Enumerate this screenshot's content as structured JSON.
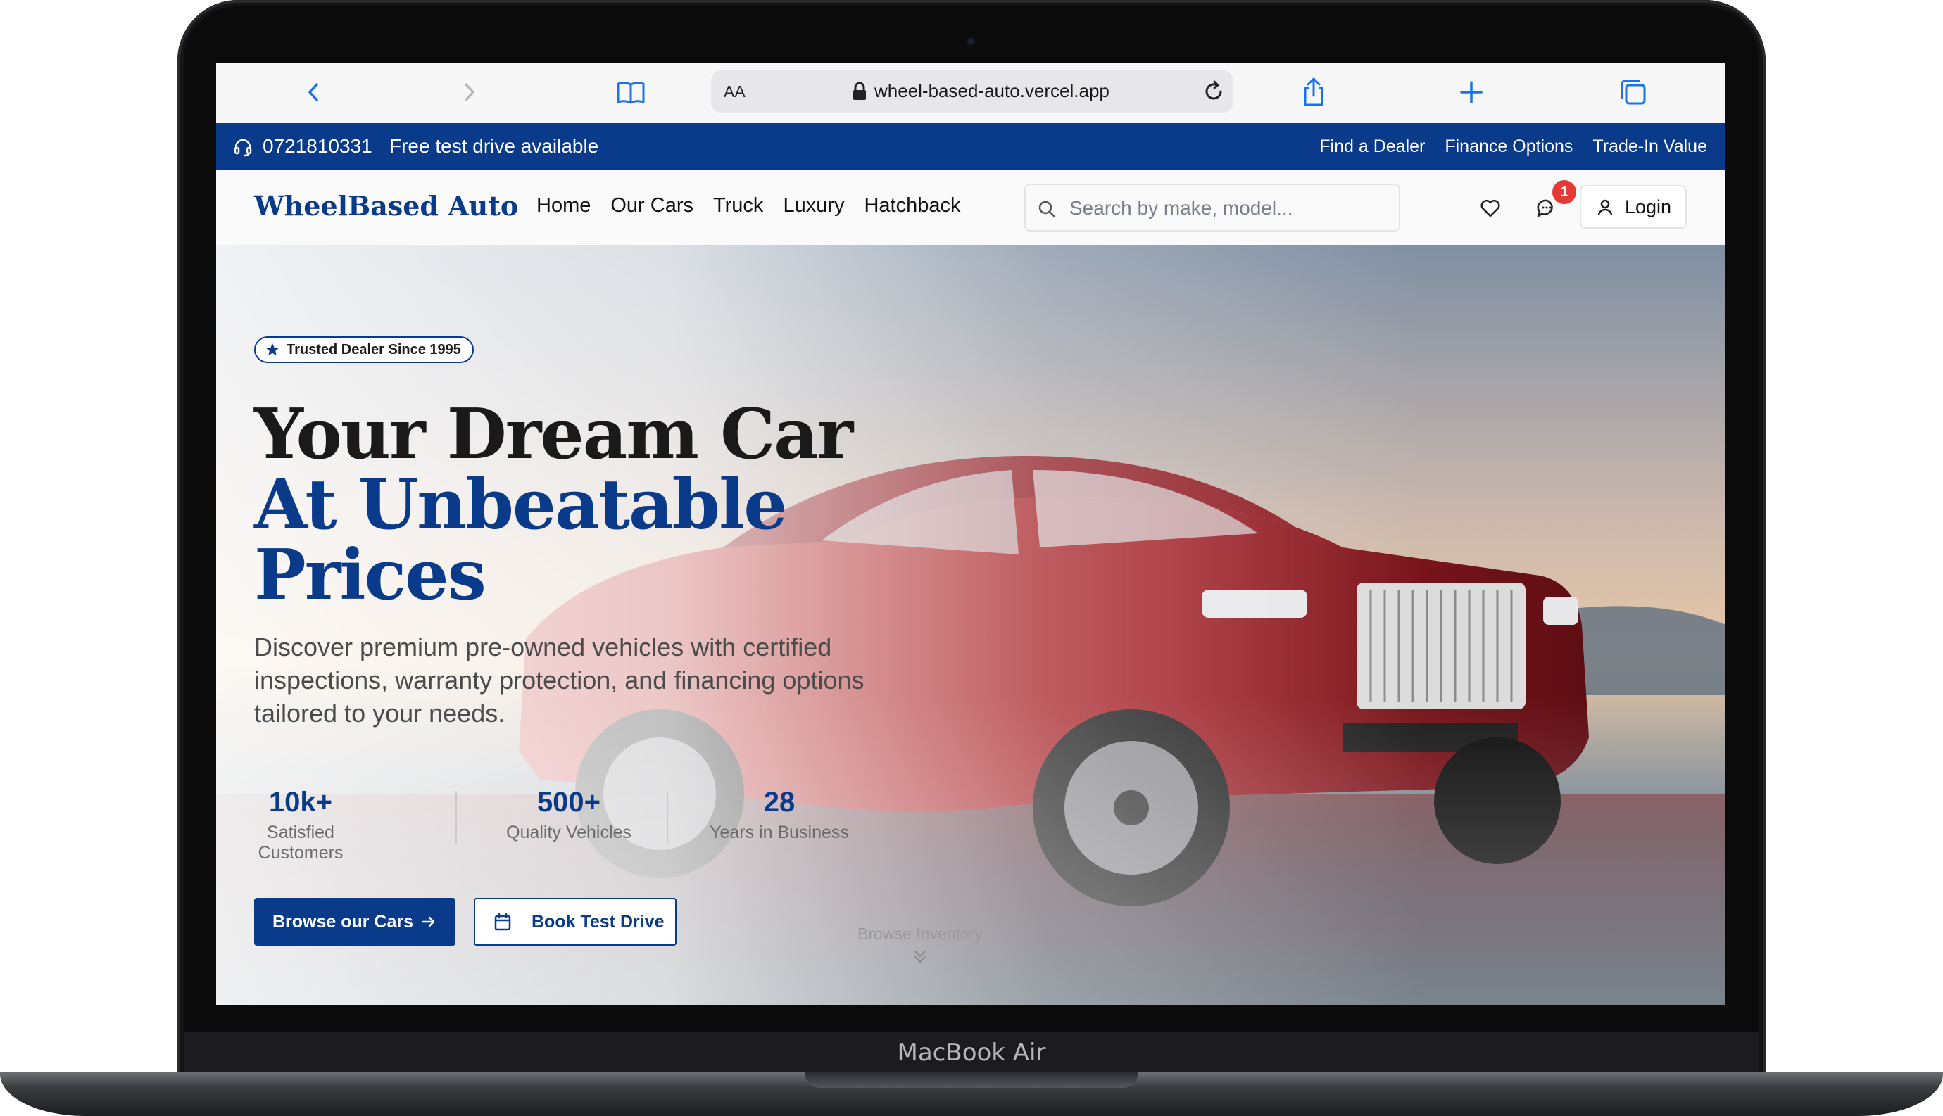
{
  "device": {
    "label": "MacBook Air"
  },
  "browser": {
    "text_size_label": "AA",
    "url": "wheel-based-auto.vercel.app"
  },
  "topbar": {
    "phone": "0721810331",
    "promo": "Free test drive available",
    "links": [
      "Find a Dealer",
      "Finance Options",
      "Trade-In Value"
    ]
  },
  "nav": {
    "brand": "WheelBased Auto",
    "links": [
      "Home",
      "Our Cars",
      "Truck",
      "Luxury",
      "Hatchback"
    ],
    "search_placeholder": "Search by make, model...",
    "chat_badge": "1",
    "login_label": "Login"
  },
  "hero": {
    "badge": "Trusted Dealer Since 1995",
    "headline_line1": "Your Dream Car",
    "headline_line2": "At Unbeatable",
    "headline_line3": "Prices",
    "description": "Discover premium pre-owned vehicles with certified inspections, warranty protection, and financing options tailored to your needs.",
    "stats": [
      {
        "value": "10k+",
        "label": "Satisfied Customers"
      },
      {
        "value": "500+",
        "label": "Quality Vehicles"
      },
      {
        "value": "28",
        "label": "Years in Business"
      }
    ],
    "primary_button": "Browse our Cars",
    "secondary_button": "Book Test Drive",
    "scroll_hint": "Browse Inventory"
  },
  "colors": {
    "brand_blue": "#0a3a8a",
    "badge_red": "#e53935"
  },
  "icons": {
    "back": "chevron-left-icon",
    "forward": "chevron-right-icon",
    "bookmarks": "book-icon",
    "share": "share-icon",
    "new_tab": "plus-icon",
    "tabs": "tabs-icon",
    "phone": "headset-icon",
    "search": "search-icon",
    "wishlist": "heart-icon",
    "messages": "chat-icon",
    "account": "user-icon"
  }
}
